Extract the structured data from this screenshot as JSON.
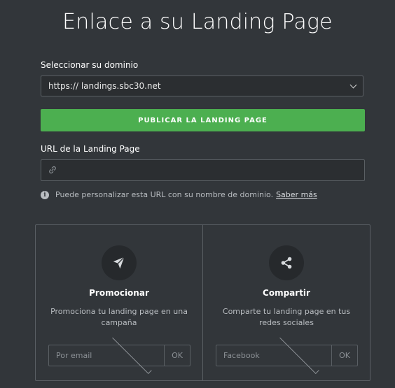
{
  "header": {
    "title": "Enlace a su Landing Page"
  },
  "domain": {
    "label": "Seleccionar su dominio",
    "selected": "https:// landings.sbc30.net"
  },
  "publish_button": "PUBLICAR LA LANDING PAGE",
  "url": {
    "label": "URL de la Landing Page",
    "value": "",
    "placeholder": ""
  },
  "hint": {
    "text": "Puede personalizar esta URL con su nombre de dominio.",
    "link": "Saber más"
  },
  "cards": [
    {
      "icon": "paper-plane-icon",
      "title": "Promocionar",
      "description": "Promociona tu landing page en una campaña",
      "select": "Por email",
      "ok": "OK"
    },
    {
      "icon": "share-icon",
      "title": "Compartir",
      "description": "Comparte tu landing page en tus redes sociales",
      "select": "Facebook",
      "ok": "OK"
    }
  ]
}
